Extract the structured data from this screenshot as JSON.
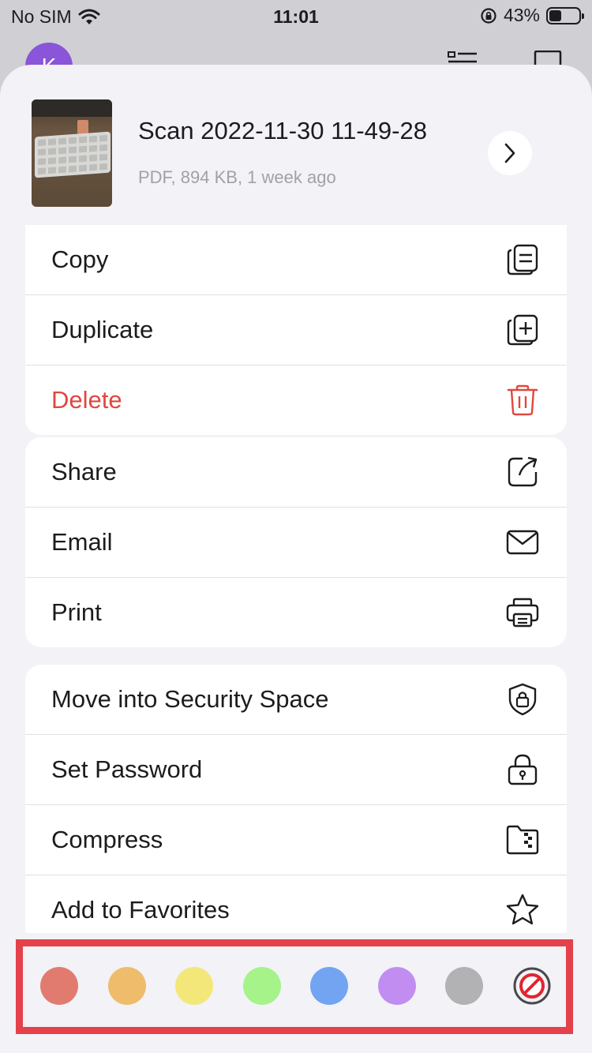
{
  "status_bar": {
    "carrier": "No SIM",
    "time": "11:01",
    "battery_percent": "43%",
    "battery_level": 0.43
  },
  "background": {
    "avatar_letter": "K"
  },
  "file": {
    "name": "Scan 2022-11-30 11-49-28",
    "meta": "PDF, 894 KB, 1 week ago"
  },
  "menu_groups": [
    {
      "items": [
        {
          "label": "Copy",
          "icon": "copy-icon"
        },
        {
          "label": "Duplicate",
          "icon": "duplicate-icon"
        },
        {
          "label": "Delete",
          "icon": "trash-icon",
          "color": "#e0483e"
        }
      ]
    },
    {
      "items": [
        {
          "label": "Share",
          "icon": "share-icon"
        },
        {
          "label": "Email",
          "icon": "envelope-icon"
        },
        {
          "label": "Print",
          "icon": "printer-icon"
        }
      ]
    },
    {
      "items": [
        {
          "label": "Move into Security Space",
          "icon": "shield-lock-icon"
        },
        {
          "label": "Set Password",
          "icon": "lock-icon"
        },
        {
          "label": "Compress",
          "icon": "zip-folder-icon"
        },
        {
          "label": "Add to Favorites",
          "icon": "star-icon"
        }
      ]
    }
  ],
  "color_tags": [
    "#e27b6f",
    "#efbc6c",
    "#f4e77a",
    "#a6f38a",
    "#72a4f2",
    "#c28df1",
    "#b2b2b5"
  ],
  "highlight_color": "#e4414a"
}
